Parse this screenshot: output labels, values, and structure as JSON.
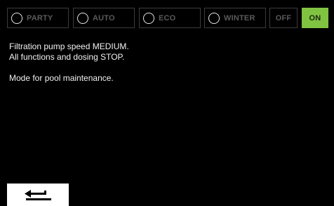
{
  "modes": {
    "party": "PARTY",
    "auto": "AUTO",
    "eco": "ECO",
    "winter": "WINTER",
    "off": "OFF",
    "on": "ON"
  },
  "description": {
    "line1": "Filtration pump speed MEDIUM.",
    "line2": "All functions and dosing STOP.",
    "line3": "Mode for pool maintenance."
  },
  "colors": {
    "background": "#000000",
    "active_on": "#80c341",
    "inactive_text": "#5a5a5a",
    "text": "#f2f2f2"
  },
  "icons": {
    "back": "return-arrow-icon",
    "radio": "radio-circle-icon"
  }
}
